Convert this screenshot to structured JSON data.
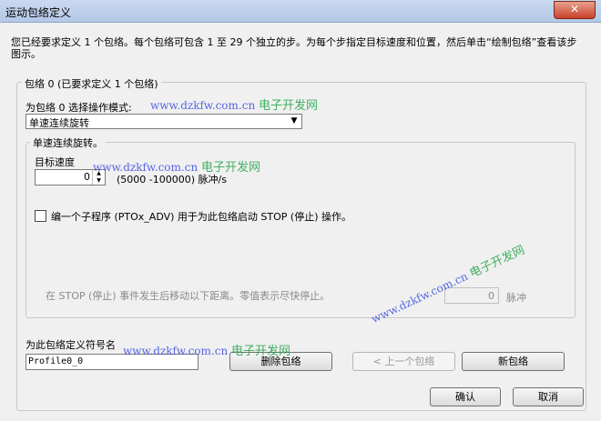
{
  "window": {
    "title": "运动包络定义",
    "close_glyph": "✕"
  },
  "intro": "您已经要求定义 1 个包络。每个包络可包含 1 至 29 个独立的步。为每个步指定目标速度和位置，然后单击“绘制包络”查看该步图示。",
  "envelope_group": {
    "legend": "包络 0 (已要求定义 1 个包络)",
    "mode_label": "为包络 0 选择操作模式:",
    "mode_value": "单速连续旋转",
    "sub_group": {
      "legend": "单速连续旋转。",
      "target_speed_label": "目标速度",
      "target_speed_value": "0",
      "speed_range": "(5000 -100000) 脉冲/s",
      "subroutine_checkbox_label": "编一个子程序 (PTOx_ADV) 用于为此包络启动 STOP (停止) 操作。",
      "stop_distance_label": "在 STOP (停止) 事件发生后移动以下距离。零值表示尽快停止。",
      "stop_distance_value": "0",
      "stop_distance_unit": "脉冲"
    }
  },
  "symbol_name_label": "为此包络定义符号名",
  "symbol_name_value": "Profile0_0",
  "buttons": {
    "delete": "删除包络",
    "prev": "< 上一个包络",
    "new": "新包络",
    "ok": "确认",
    "cancel": "取消"
  },
  "watermark": {
    "url": "www.dzkfw.com.cn",
    "cn": "电子开发网"
  }
}
